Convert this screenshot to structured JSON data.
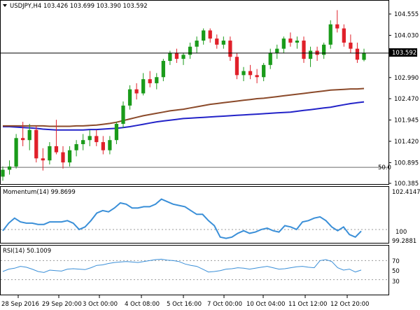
{
  "header": {
    "symbol_line": "USDJPY,H4  103.426 103.699 103.390 103.592"
  },
  "price_panel": {
    "y_ticks": [
      "104.555",
      "104.030",
      "103.592",
      "102.990",
      "102.470",
      "101.945",
      "101.420",
      "100.895",
      "100.385"
    ],
    "y_tick_values": [
      104.555,
      104.03,
      103.592,
      102.99,
      102.47,
      101.945,
      101.42,
      100.895,
      100.385
    ],
    "current_price_label": "103.592",
    "current_price": 103.592,
    "level_label": "50.0",
    "level_price": 100.78
  },
  "momentum_panel": {
    "title": "Momentum(14) 99.8699",
    "y_ticks": [
      "102.4147",
      "100",
      "99.2881"
    ]
  },
  "rsi_panel": {
    "title": "RSI(14) 50.1009",
    "y_ticks": [
      "70",
      "50",
      "30"
    ]
  },
  "x_axis": {
    "labels": [
      "28 Sep 2016",
      "29 Sep 20:00",
      "3 Oct 00:00",
      "4 Oct 08:00",
      "5 Oct 16:00",
      "7 Oct 00:00",
      "10 Oct 04:00",
      "11 Oct 12:00",
      "12 Oct 20:00"
    ]
  },
  "colors": {
    "bull": "#1a9b1a",
    "bear": "#e0202a",
    "ma_slow": "#2323c8",
    "ma_fast": "#8b4a2a",
    "indicator": "#3a8fd8",
    "level": "#6b6b6b"
  },
  "chart_data": [
    {
      "type": "candlestick",
      "title": "USDJPY,H4",
      "ohlc": [
        [
          100.55,
          100.8,
          100.45,
          100.72
        ],
        [
          100.72,
          100.95,
          100.6,
          100.8
        ],
        [
          100.8,
          101.6,
          100.75,
          101.5
        ],
        [
          101.5,
          101.9,
          101.3,
          101.45
        ],
        [
          101.45,
          101.85,
          101.2,
          101.7
        ],
        [
          101.7,
          101.8,
          100.9,
          101.0
        ],
        [
          101.0,
          101.25,
          100.7,
          100.95
        ],
        [
          100.95,
          101.4,
          100.85,
          101.3
        ],
        [
          101.3,
          101.95,
          101.1,
          101.15
        ],
        [
          101.15,
          101.3,
          100.75,
          100.9
        ],
        [
          100.9,
          101.3,
          100.8,
          101.2
        ],
        [
          101.2,
          101.45,
          101.05,
          101.35
        ],
        [
          101.35,
          101.6,
          101.2,
          101.45
        ],
        [
          101.45,
          101.7,
          101.3,
          101.55
        ],
        [
          101.55,
          101.7,
          101.3,
          101.4
        ],
        [
          101.4,
          101.55,
          101.1,
          101.2
        ],
        [
          101.2,
          101.55,
          101.1,
          101.45
        ],
        [
          101.45,
          101.9,
          101.35,
          101.85
        ],
        [
          101.85,
          102.4,
          101.75,
          102.3
        ],
        [
          102.3,
          102.8,
          102.2,
          102.7
        ],
        [
          102.7,
          102.85,
          102.45,
          102.6
        ],
        [
          102.6,
          103.1,
          102.55,
          102.95
        ],
        [
          102.95,
          103.15,
          102.75,
          102.85
        ],
        [
          102.85,
          103.1,
          102.7,
          103.0
        ],
        [
          103.0,
          103.45,
          102.9,
          103.4
        ],
        [
          103.4,
          103.65,
          103.3,
          103.6
        ],
        [
          103.6,
          103.7,
          103.35,
          103.45
        ],
        [
          103.45,
          103.6,
          103.3,
          103.55
        ],
        [
          103.55,
          103.85,
          103.45,
          103.75
        ],
        [
          103.75,
          104.0,
          103.6,
          103.9
        ],
        [
          103.9,
          104.2,
          103.8,
          104.15
        ],
        [
          104.15,
          104.2,
          103.85,
          103.95
        ],
        [
          103.95,
          104.05,
          103.7,
          103.8
        ],
        [
          103.8,
          104.0,
          103.7,
          103.9
        ],
        [
          103.9,
          104.0,
          103.4,
          103.5
        ],
        [
          103.5,
          103.6,
          102.95,
          103.05
        ],
        [
          103.05,
          103.25,
          102.9,
          103.15
        ],
        [
          103.15,
          103.3,
          102.95,
          103.05
        ],
        [
          103.05,
          103.2,
          102.85,
          103.0
        ],
        [
          103.0,
          103.35,
          102.9,
          103.3
        ],
        [
          103.3,
          103.7,
          103.2,
          103.6
        ],
        [
          103.6,
          103.8,
          103.45,
          103.7
        ],
        [
          103.7,
          104.0,
          103.6,
          103.95
        ],
        [
          103.95,
          104.1,
          103.75,
          103.85
        ],
        [
          103.85,
          104.0,
          103.7,
          103.9
        ],
        [
          103.9,
          104.0,
          103.35,
          103.45
        ],
        [
          103.45,
          103.75,
          103.25,
          103.65
        ],
        [
          103.65,
          103.75,
          103.4,
          103.55
        ],
        [
          103.55,
          103.85,
          103.45,
          103.8
        ],
        [
          103.8,
          104.4,
          103.7,
          104.3
        ],
        [
          104.3,
          104.65,
          104.1,
          104.2
        ],
        [
          104.2,
          104.3,
          103.75,
          103.85
        ],
        [
          103.85,
          104.05,
          103.6,
          103.7
        ],
        [
          103.7,
          103.85,
          103.35,
          103.43
        ],
        [
          103.426,
          103.699,
          103.39,
          103.592
        ]
      ],
      "ma_slow": [
        101.78,
        101.78,
        101.77,
        101.76,
        101.75,
        101.74,
        101.72,
        101.71,
        101.7,
        101.7,
        101.7,
        101.7,
        101.7,
        101.71,
        101.71,
        101.72,
        101.73,
        101.74,
        101.76,
        101.78,
        101.81,
        101.84,
        101.87,
        101.9,
        101.92,
        101.94,
        101.96,
        101.98,
        101.99,
        102.0,
        102.01,
        102.02,
        102.03,
        102.04,
        102.05,
        102.06,
        102.07,
        102.08,
        102.09,
        102.1,
        102.11,
        102.12,
        102.13,
        102.14,
        102.16,
        102.18,
        102.2,
        102.22,
        102.24,
        102.26,
        102.29,
        102.32,
        102.35,
        102.37,
        102.39
      ],
      "ma_fast": [
        101.8,
        101.8,
        101.8,
        101.8,
        101.8,
        101.8,
        101.8,
        101.79,
        101.79,
        101.79,
        101.79,
        101.8,
        101.8,
        101.81,
        101.82,
        101.84,
        101.86,
        101.89,
        101.93,
        101.97,
        102.01,
        102.05,
        102.08,
        102.11,
        102.14,
        102.17,
        102.19,
        102.21,
        102.24,
        102.27,
        102.3,
        102.33,
        102.35,
        102.37,
        102.39,
        102.41,
        102.43,
        102.45,
        102.47,
        102.48,
        102.5,
        102.52,
        102.54,
        102.56,
        102.58,
        102.6,
        102.62,
        102.64,
        102.66,
        102.68,
        102.69,
        102.7,
        102.71,
        102.71,
        102.72
      ]
    },
    {
      "type": "line",
      "title": "Momentum(14) 99.8699",
      "ylim": [
        99.0,
        102.6
      ],
      "values": [
        99.9,
        100.5,
        100.9,
        100.6,
        100.5,
        100.5,
        100.4,
        100.4,
        100.6,
        100.6,
        100.6,
        100.7,
        100.5,
        100.0,
        100.2,
        100.7,
        101.3,
        101.5,
        101.4,
        101.7,
        102.1,
        102.0,
        101.7,
        101.7,
        101.8,
        101.8,
        102.0,
        102.4,
        102.2,
        102.0,
        101.9,
        101.8,
        101.5,
        101.2,
        101.2,
        100.7,
        100.3,
        99.4,
        99.3,
        99.4,
        99.7,
        99.9,
        99.7,
        99.8,
        100.0,
        100.1,
        99.9,
        99.8,
        100.3,
        100.2,
        100.0,
        100.6,
        100.7,
        100.9,
        101.0,
        100.7,
        100.2,
        99.9,
        100.2,
        99.6,
        99.4,
        99.87
      ]
    },
    {
      "type": "line",
      "title": "RSI(14) 50.1009",
      "ylim": [
        0,
        100
      ],
      "values": [
        47,
        52,
        54,
        58,
        56,
        52,
        47,
        45,
        50,
        49,
        48,
        52,
        53,
        52,
        51,
        55,
        60,
        61,
        64,
        66,
        67,
        68,
        67,
        66,
        68,
        70,
        72,
        73,
        71,
        70,
        68,
        63,
        60,
        58,
        52,
        46,
        47,
        49,
        52,
        53,
        55,
        54,
        52,
        54,
        56,
        58,
        55,
        52,
        53,
        55,
        57,
        58,
        56,
        55,
        70,
        72,
        68,
        55,
        50,
        52,
        46,
        50.1
      ]
    }
  ]
}
